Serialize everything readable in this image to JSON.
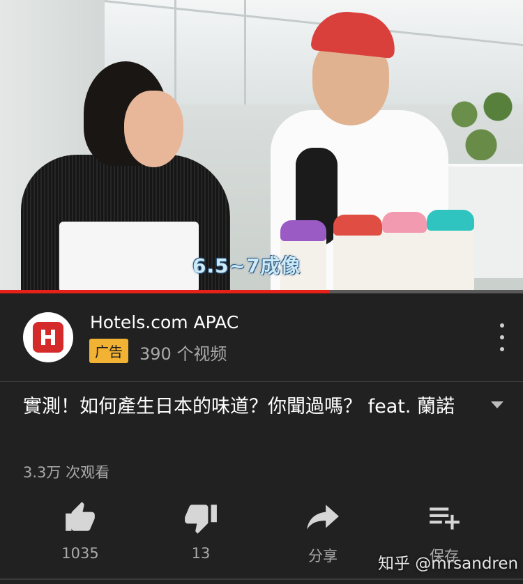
{
  "video": {
    "subtitle": "6.5~7成像",
    "progress": 0.63
  },
  "channel": {
    "name": "Hotels.com APAC",
    "ad_label": "广告",
    "video_count": "390 个视频",
    "avatar_icon": "hotels-logo-icon",
    "avatar_letter": "H"
  },
  "video_info": {
    "title": "實測！如何產生日本的味道？你聞過嗎？ feat. 蘭諾",
    "views": "3.3万 次观看"
  },
  "actions": {
    "like": {
      "icon": "thumbs-up-icon",
      "label": "1035"
    },
    "dislike": {
      "icon": "thumbs-down-icon",
      "label": "13"
    },
    "share": {
      "icon": "share-icon",
      "label": "分享"
    },
    "save": {
      "icon": "playlist-add-icon",
      "label": "保存"
    }
  },
  "watermark": "知乎 @mrsandren",
  "colors": {
    "background": "#212121",
    "progress": "#e62117",
    "ad_badge": "#f2b233",
    "secondary_text": "#aaaaaa"
  }
}
